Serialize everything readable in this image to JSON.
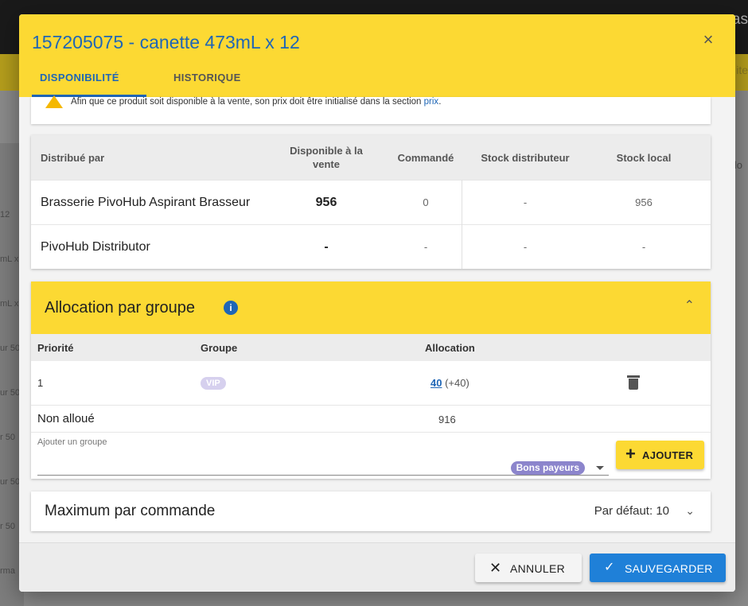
{
  "background": {
    "top_fragment": "as",
    "yellow_fragment": "ite",
    "left_fragments": [
      "12",
      "mL x",
      "mL x",
      "ur 50",
      "ur 50",
      "r 50",
      "ur 50",
      "r 50",
      "rma"
    ],
    "right_fragment": "llo"
  },
  "modal": {
    "title": "157205075 - canette 473mL x 12",
    "close_icon": "×",
    "tabs": [
      {
        "label": "DISPONIBILITÉ",
        "active": true
      },
      {
        "label": "HISTORIQUE",
        "active": false
      }
    ]
  },
  "warning": {
    "text": "Afin que ce produit soit disponible à la vente, son prix doit être initialisé dans la section ",
    "link": "prix",
    "suffix": "."
  },
  "distributors": {
    "headers": {
      "distributor": "Distribué par",
      "available": "Disponible à la vente",
      "ordered": "Commandé",
      "distributor_stock": "Stock distributeur",
      "local_stock": "Stock local"
    },
    "rows": [
      {
        "name": "Brasserie PivoHub Aspirant Brasseur",
        "available": "956",
        "ordered": "0",
        "distributor_stock": "-",
        "local_stock": "956"
      },
      {
        "name": "PivoHub Distributor",
        "available": "-",
        "ordered": "-",
        "distributor_stock": "-",
        "local_stock": "-"
      }
    ]
  },
  "allocation": {
    "title": "Allocation par groupe",
    "info_icon": "i",
    "collapse_icon": "⌃",
    "headers": {
      "priority": "Priorité",
      "group": "Groupe",
      "allocation": "Allocation"
    },
    "rows": [
      {
        "priority": "1",
        "group": "VIP",
        "allocation": "40",
        "delta": "(+40)"
      }
    ],
    "unallocated_label": "Non alloué",
    "unallocated_value": "916",
    "add_group_label": "Ajouter un groupe",
    "selected_group": "Bons payeurs",
    "add_button": "AJOUTER",
    "add_icon": "+"
  },
  "max_per_order": {
    "title": "Maximum par commande",
    "default_text": "Par défaut: 10",
    "expand_icon": "⌄"
  },
  "footer": {
    "cancel_label": "ANNULER",
    "cancel_icon": "✕",
    "save_label": "SAUVEGARDER",
    "save_icon": "✓"
  },
  "colors": {
    "accent_yellow": "#fcd933",
    "primary_blue": "#1f66b6",
    "save_blue": "#1f80d8",
    "vip_chip": "#d6d0ee",
    "group_chip": "#8c85cc"
  }
}
